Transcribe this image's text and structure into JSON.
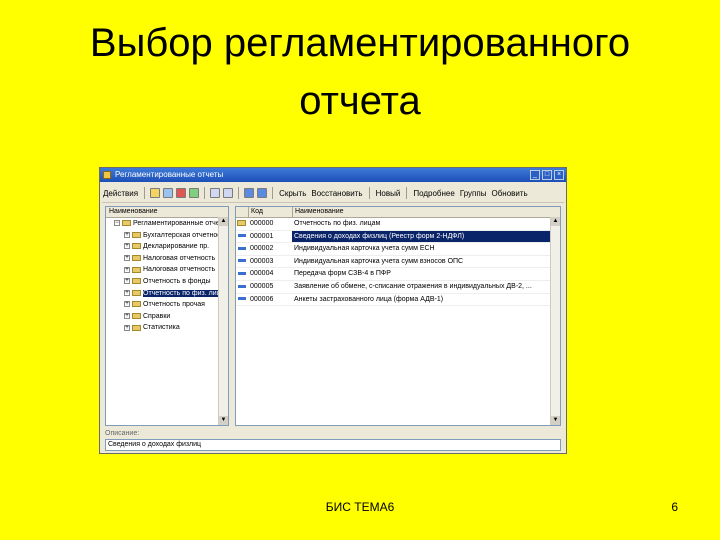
{
  "slide": {
    "title_line1": "Выбор регламентированного",
    "title_line2": "отчета",
    "footer": "БИС ТЕМА6",
    "page_number": "6",
    "background": "#ffff00"
  },
  "window": {
    "title": "Регламентированные отчеты",
    "toolbar": {
      "actions_label": "Действия",
      "hide_label": "Скрыть",
      "restore_label": "Восстановить",
      "new_label": "Новый",
      "details_label": "Подробнее",
      "help_label": "Группы",
      "refresh_label": "Обновить"
    },
    "tree": {
      "header": "Наименование",
      "items": [
        {
          "label": "Регламентированные отчеты",
          "expanded": true,
          "child": false
        },
        {
          "label": "Бухгалтерская отчетность",
          "child": true
        },
        {
          "label": "Декларирование пр.",
          "child": true
        },
        {
          "label": "Налоговая отчетность",
          "child": true
        },
        {
          "label": "Налоговая отчетность",
          "child": true
        },
        {
          "label": "Отчетность в фонды",
          "child": true
        },
        {
          "label": "Отчетность по физ. лицам",
          "child": true,
          "selected": true
        },
        {
          "label": "Отчетность прочая",
          "child": true
        },
        {
          "label": "Справки",
          "child": true
        },
        {
          "label": "Статистика",
          "child": true
        }
      ]
    },
    "list": {
      "col_code": "Код",
      "col_name": "Наименование",
      "rows": [
        {
          "code": "000000",
          "name": "Отчетность по физ. лицам",
          "folder": true
        },
        {
          "code": "000001",
          "name": "Сведения о доходах физлиц (Реестр форм 2-НДФЛ)",
          "selected": true
        },
        {
          "code": "000002",
          "name": "Индивидуальная карточка учета сумм ЕСН"
        },
        {
          "code": "000003",
          "name": "Индивидуальная карточка учета сумм взносов ОПС"
        },
        {
          "code": "000004",
          "name": "Передача форм СЗВ-4 в ПФР"
        },
        {
          "code": "000005",
          "name": "Заявление об обмене, с-списание отражения в индивидуальных ДВ-2, ..."
        },
        {
          "code": "000006",
          "name": "Анкеты застрахованного лица (форма АДВ-1)"
        }
      ]
    },
    "description_label": "Описание:",
    "description": "Сведения о доходах физлиц"
  }
}
